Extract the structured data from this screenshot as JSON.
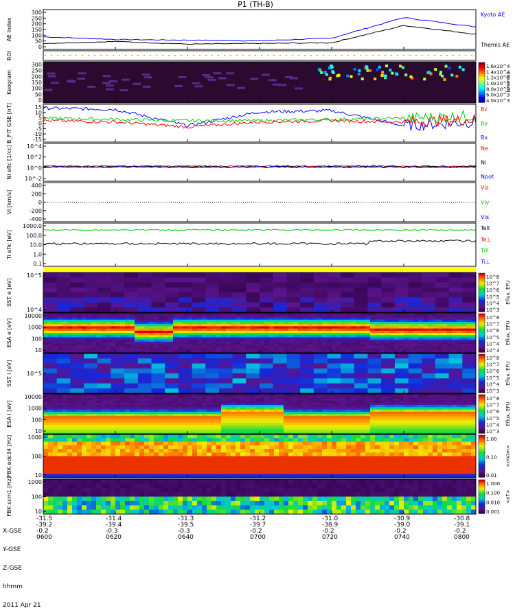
{
  "title": "P1 (TH-B)",
  "footer": {
    "row_labels": [
      "X-GSE",
      "Y-GSE",
      "Z-GSE",
      "hhmm",
      "2011 Apr 21"
    ],
    "tick_columns": [
      {
        "x_gse": "-31.5",
        "y_gse": "-39.2",
        "z_gse": "-0.2",
        "hhmm": "0600"
      },
      {
        "x_gse": "-31.4",
        "y_gse": "-39.4",
        "z_gse": "-0.3",
        "hhmm": "0620"
      },
      {
        "x_gse": "-31.3",
        "y_gse": "-39.5",
        "z_gse": "-0.3",
        "hhmm": "0640"
      },
      {
        "x_gse": "-31.2",
        "y_gse": "-39.7",
        "z_gse": "-0.2",
        "hhmm": "0700"
      },
      {
        "x_gse": "-31.0",
        "y_gse": "-38.9",
        "z_gse": "-0.2",
        "hhmm": "0720"
      },
      {
        "x_gse": "-30.9",
        "y_gse": "-39.0",
        "z_gse": "-0.2",
        "hhmm": "0740"
      },
      {
        "x_gse": "-30.8",
        "y_gse": "-39.1",
        "z_gse": "-0.2",
        "hhmm": "0800"
      }
    ]
  },
  "chart_data": [
    {
      "type": "line",
      "panel": "ae",
      "ylabel": "AE Index",
      "y_ticks": [
        "300",
        "250",
        "200",
        "150",
        "100",
        "50",
        "0"
      ],
      "ylim": [
        0,
        300
      ],
      "x": [
        "0600",
        "0620",
        "0640",
        "0700",
        "0720",
        "0740",
        "0800"
      ],
      "series": [
        {
          "name": "Kyoto AE",
          "color": "#0000ff",
          "values": [
            95,
            75,
            70,
            65,
            85,
            240,
            170
          ]
        },
        {
          "name": "Themis AE",
          "color": "#000000",
          "values": [
            45,
            60,
            40,
            45,
            50,
            180,
            115
          ]
        }
      ]
    },
    {
      "type": "heatmap",
      "panel": "roi",
      "ylabel": "ROI"
    },
    {
      "type": "heatmap",
      "panel": "keogram",
      "ylabel": "Keogram",
      "y_ticks": [
        "300",
        "250",
        "200",
        "150",
        "100",
        "50",
        "0"
      ],
      "colorbar_ticks": [
        "1.6x10^4",
        "1.4x10^4",
        "1.2x10^4",
        "1.0x10^4",
        "8.0x10^3",
        "6.0x10^3",
        "4.0x10^3"
      ],
      "colorbar_label": "[counts]"
    },
    {
      "type": "line",
      "panel": "bfield",
      "ylabel": "B_FIT GSE [nT]",
      "y_ticks": [
        "15",
        "10",
        "5",
        "0",
        "-5",
        "-10",
        "-15"
      ],
      "ylim": [
        -15,
        15
      ],
      "x": [
        "0600",
        "0620",
        "0640",
        "0700",
        "0720",
        "0740",
        "0800"
      ],
      "series": [
        {
          "name": "Bz",
          "color": "#ff0000",
          "values": [
            2,
            1,
            -3,
            1,
            2,
            1,
            3
          ]
        },
        {
          "name": "By",
          "color": "#00cc00",
          "values": [
            4,
            3,
            2,
            2,
            3,
            4,
            6
          ]
        },
        {
          "name": "Bx",
          "color": "#0000ff",
          "values": [
            12,
            11,
            -2,
            9,
            10,
            -2,
            1
          ]
        }
      ]
    },
    {
      "type": "line",
      "panel": "density",
      "ylabel": "Ni eflc [1/cc]",
      "y_ticks": [
        "10^4",
        "10^2",
        "10^0",
        "10^-2"
      ],
      "series": [
        {
          "name": "Ne",
          "color": "#ff0000"
        },
        {
          "name": "Ni",
          "color": "#000000"
        },
        {
          "name": "Npot",
          "color": "#0000ff"
        }
      ]
    },
    {
      "type": "line",
      "panel": "velocity",
      "ylabel": "Vi [km/s]",
      "y_ticks": [
        "400",
        "200",
        "0",
        "-200",
        "-400"
      ],
      "ylim": [
        -500,
        500
      ],
      "series": [
        {
          "name": "Viz",
          "color": "#ff0000"
        },
        {
          "name": "Viy",
          "color": "#00cc00"
        },
        {
          "name": "Vix",
          "color": "#0000ff"
        }
      ]
    },
    {
      "type": "line",
      "panel": "temperature",
      "ylabel": "Ti eflc [eV]",
      "y_ticks": [
        "1000.0",
        "100.0",
        "10.0",
        "1.0",
        "0.1"
      ],
      "series": [
        {
          "name": "TeII",
          "color": "#000000"
        },
        {
          "name": "Te⊥",
          "color": "#ff0000"
        },
        {
          "name": "TiII",
          "color": "#00cc00"
        },
        {
          "name": "Ti⊥",
          "color": "#0000ff"
        }
      ]
    },
    {
      "type": "heatmap",
      "panel": "sst_e",
      "ylabel": "SST e [eV]",
      "y_ticks": [
        "10^5",
        "10^4"
      ],
      "colorbar_ticks": [
        "10^8",
        "10^7",
        "10^6",
        "10^5",
        "10^4",
        "10^3"
      ],
      "colorbar_label": "Eflux, EFU"
    },
    {
      "type": "heatmap",
      "panel": "esa_e",
      "ylabel": "ESA e [eV]",
      "y_ticks": [
        "10000",
        "1000",
        "100",
        "10"
      ],
      "colorbar_ticks": [
        "10^8",
        "10^7",
        "10^6",
        "10^5",
        "10^4",
        "10^3"
      ],
      "colorbar_label": "Eflux, EFU"
    },
    {
      "type": "heatmap",
      "panel": "sst_i",
      "ylabel": "SST i [eV]",
      "y_ticks": [
        "10^5"
      ],
      "colorbar_ticks": [
        "10^8",
        "10^7",
        "10^6",
        "10^5",
        "10^4",
        "10^3"
      ],
      "colorbar_label": "Eflux, EFU"
    },
    {
      "type": "heatmap",
      "panel": "esa_i",
      "ylabel": "ESA i [eV]",
      "y_ticks": [
        "10000",
        "1000",
        "100",
        "10"
      ],
      "colorbar_ticks": [
        "10^8",
        "10^7",
        "10^6",
        "10^5",
        "10^4",
        "10^3"
      ],
      "colorbar_label": "Eflux, EFU"
    },
    {
      "type": "heatmap",
      "panel": "fbk_e",
      "ylabel": "FBK edc34 [Hz]",
      "y_ticks": [
        "1000",
        "100",
        "10"
      ],
      "colorbar_ticks": [
        "1.00",
        "0.10",
        "0.01"
      ],
      "colorbar_label": "<mV/m>"
    },
    {
      "type": "heatmap",
      "panel": "fbk_b",
      "ylabel": "FBK scm1 [Hz]",
      "y_ticks": [
        "1000",
        "100",
        "10"
      ],
      "colorbar_ticks": [
        "1.000",
        "0.100",
        "0.010",
        "0.001"
      ],
      "colorbar_label": "<nT>"
    }
  ]
}
